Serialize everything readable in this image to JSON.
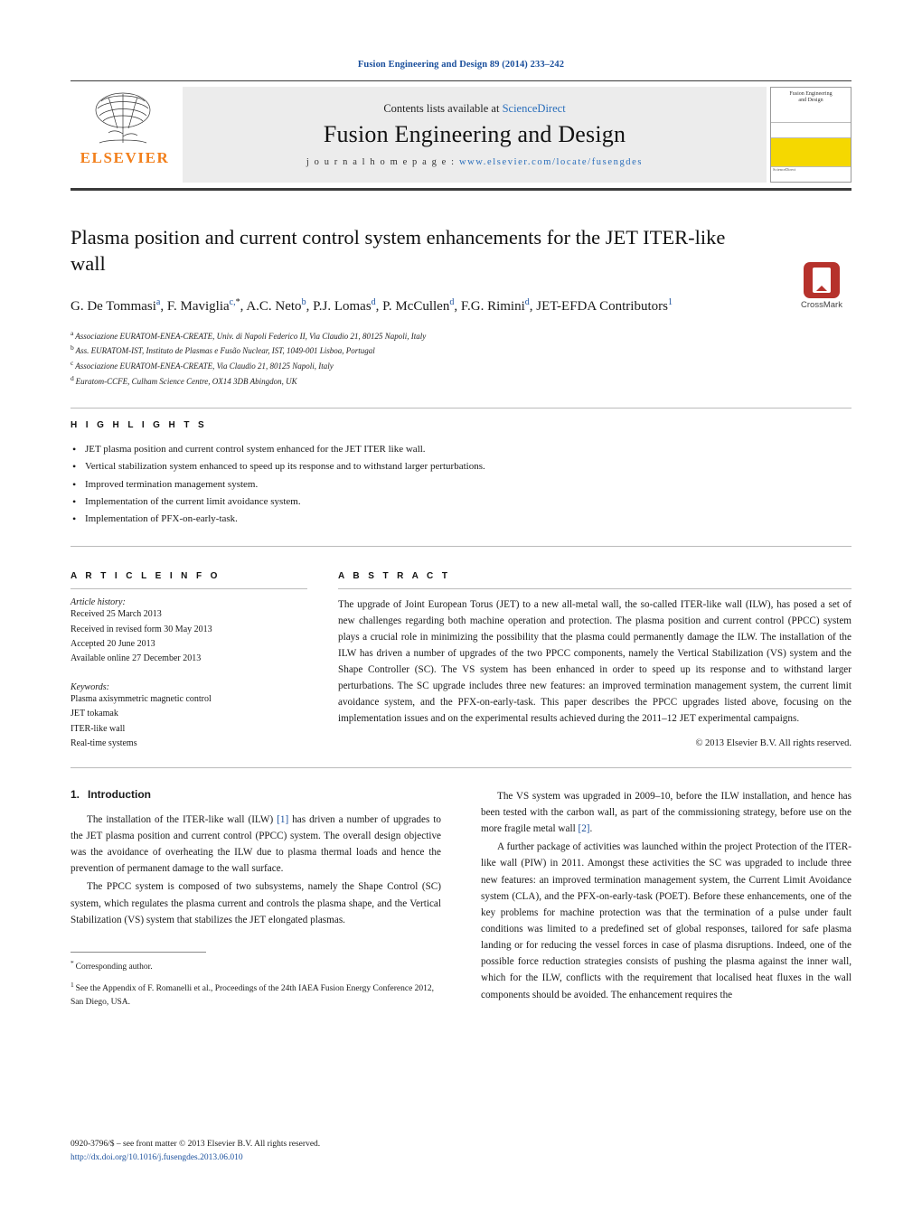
{
  "running_head": "Fusion Engineering and Design 89 (2014) 233–242",
  "masthead": {
    "publisher": "ELSEVIER",
    "contents_prefix": "Contents lists available at",
    "contents_link": "ScienceDirect",
    "journal_title": "Fusion Engineering and Design",
    "homepage_label": "j o u r n a l   h o m e p a g e :",
    "homepage_url": "www.elsevier.com/locate/fusengdes",
    "cover": {
      "line1": "Fusion Engineering",
      "line2": "and Design",
      "footer": "ScienceDirect"
    }
  },
  "article": {
    "title": "Plasma position and current control system enhancements for the JET ITER-like wall",
    "crossmark_label": "CrossMark",
    "authors": [
      {
        "name": "G. De Tommasi",
        "sup": "a",
        "sep": ", "
      },
      {
        "name": "F. Maviglia",
        "sup": "c,",
        "star": "*",
        "sep": ", "
      },
      {
        "name": "A.C. Neto",
        "sup": "b",
        "sep": ", "
      },
      {
        "name": "P.J. Lomas",
        "sup": "d",
        "sep": ", "
      },
      {
        "name": "P. McCullen",
        "sup": "d",
        "sep": ", "
      },
      {
        "name": "F.G. Rimini",
        "sup": "d",
        "sep": ","
      },
      {
        "name": "JET-EFDA Contributors",
        "sup": "1",
        "sep": ""
      }
    ],
    "affiliations": [
      {
        "sup": "a",
        "text": "Associazione EURATOM-ENEA-CREATE, Univ. di Napoli Federico II, Via Claudio 21, 80125 Napoli, Italy"
      },
      {
        "sup": "b",
        "text": "Ass. EURATOM-IST, Instituto de Plasmas e Fusão Nuclear, IST, 1049-001 Lisboa, Portugal"
      },
      {
        "sup": "c",
        "text": "Associazione EURATOM-ENEA-CREATE, Via Claudio 21, 80125 Napoli, Italy"
      },
      {
        "sup": "d",
        "text": "Euratom-CCFE, Culham Science Centre, OX14 3DB Abingdon, UK"
      }
    ]
  },
  "highlights": {
    "heading": "H I G H L I G H T S",
    "items": [
      "JET plasma position and current control system enhanced for the JET ITER like wall.",
      "Vertical stabilization system enhanced to speed up its response and to withstand larger perturbations.",
      "Improved termination management system.",
      "Implementation of the current limit avoidance system.",
      "Implementation of PFX-on-early-task."
    ]
  },
  "article_info": {
    "heading": "A R T I C L E   I N F O",
    "history_label": "Article history:",
    "history": [
      "Received 25 March 2013",
      "Received in revised form 30 May 2013",
      "Accepted 20 June 2013",
      "Available online 27 December 2013"
    ],
    "keywords_label": "Keywords:",
    "keywords": [
      "Plasma axisymmetric magnetic control",
      "JET tokamak",
      "ITER-like wall",
      "Real-time systems"
    ]
  },
  "abstract": {
    "heading": "A B S T R A C T",
    "text": "The upgrade of Joint European Torus (JET) to a new all-metal wall, the so-called ITER-like wall (ILW), has posed a set of new challenges regarding both machine operation and protection. The plasma position and current control (PPCC) system plays a crucial role in minimizing the possibility that the plasma could permanently damage the ILW. The installation of the ILW has driven a number of upgrades of the two PPCC components, namely the Vertical Stabilization (VS) system and the Shape Controller (SC). The VS system has been enhanced in order to speed up its response and to withstand larger perturbations. The SC upgrade includes three new features: an improved termination management system, the current limit avoidance system, and the PFX-on-early-task. This paper describes the PPCC upgrades listed above, focusing on the implementation issues and on the experimental results achieved during the 2011–12 JET experimental campaigns.",
    "copyright": "© 2013 Elsevier B.V. All rights reserved."
  },
  "body": {
    "section_number": "1.",
    "section_title": "Introduction",
    "left_paragraphs": [
      "The installation of the ITER-like wall (ILW) [1] has driven a number of upgrades to the JET plasma position and current control (PPCC) system. The overall design objective was the avoidance of overheating the ILW due to plasma thermal loads and hence the prevention of permanent damage to the wall surface.",
      "The PPCC system is composed of two subsystems, namely the Shape Control (SC) system, which regulates the plasma current and controls the plasma shape, and the Vertical Stabilization (VS) system that stabilizes the JET elongated plasmas."
    ],
    "right_paragraphs": [
      "The VS system was upgraded in 2009–10, before the ILW installation, and hence has been tested with the carbon wall, as part of the commissioning strategy, before use on the more fragile metal wall [2].",
      "A further package of activities was launched within the project Protection of the ITER-like wall (PIW) in 2011. Amongst these activities the SC was upgraded to include three new features: an improved termination management system, the Current Limit Avoidance system (CLA), and the PFX-on-early-task (POET). Before these enhancements, one of the key problems for machine protection was that the termination of a pulse under fault conditions was limited to a predefined set of global responses, tailored for safe plasma landing or for reducing the vessel forces in case of plasma disruptions. Indeed, one of the possible force reduction strategies consists of pushing the plasma against the inner wall, which for the ILW, conflicts with the requirement that localised heat fluxes in the wall components should be avoided. The enhancement requires the"
    ]
  },
  "footnotes": [
    {
      "mark": "*",
      "text": "Corresponding author."
    },
    {
      "mark": "1",
      "text": "See the Appendix of F. Romanelli et al., Proceedings of the 24th IAEA Fusion Energy Conference 2012, San Diego, USA."
    }
  ],
  "footer": {
    "issn_line": "0920-3796/$ – see front matter © 2013 Elsevier B.V. All rights reserved.",
    "doi": "http://dx.doi.org/10.1016/j.fusengdes.2013.06.010"
  }
}
